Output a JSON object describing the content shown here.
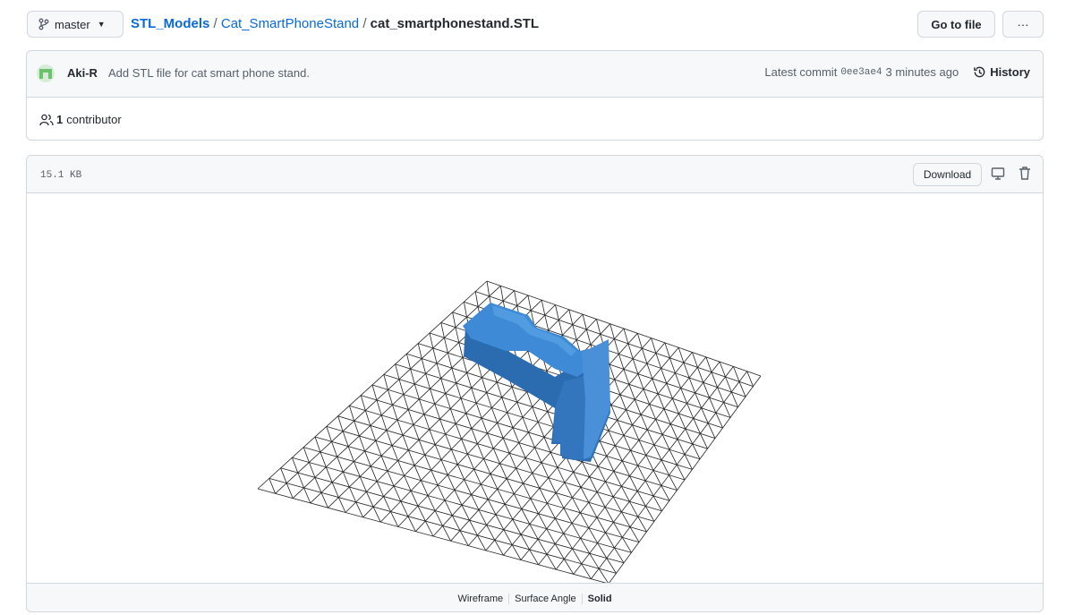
{
  "toolbar": {
    "branch": "master",
    "breadcrumb": {
      "repo": "STL_Models",
      "folder": "Cat_SmartPhoneStand",
      "file": "cat_smartphonestand.STL",
      "separator": "/"
    },
    "go_to_file": "Go to file",
    "more": "···"
  },
  "commit": {
    "author": "Aki-R",
    "message": "Add STL file for cat smart phone stand.",
    "prefix": "Latest commit",
    "sha": "0ee3ae4",
    "time": "3 minutes ago",
    "history": "History"
  },
  "contributors": {
    "count": "1",
    "label": "contributor"
  },
  "file": {
    "size": "15.1 KB",
    "download": "Download"
  },
  "viewer": {
    "modes": [
      "Wireframe",
      "Surface Angle",
      "Solid"
    ],
    "active_mode": "Solid",
    "model_color": "#3b82c8"
  },
  "colors": {
    "accent": "#0969da",
    "border": "#d0d7de"
  }
}
